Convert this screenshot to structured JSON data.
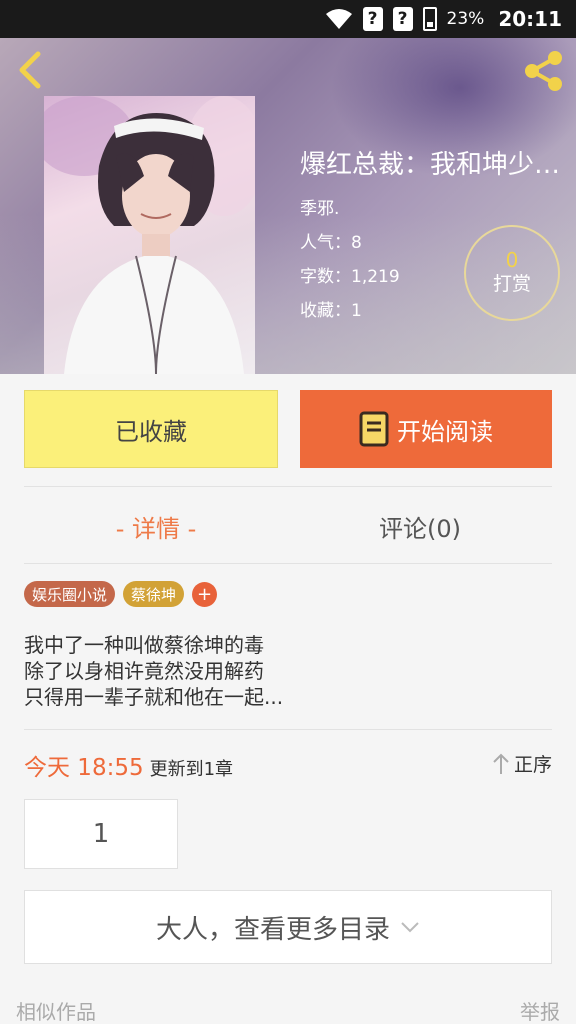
{
  "status_bar": {
    "battery": "23%",
    "time": "20:11",
    "sim1": "?",
    "sim2": "?",
    "icons": [
      "wifi-icon",
      "sim-unknown-icon",
      "battery-charging-icon"
    ]
  },
  "header": {
    "icons": [
      "back-chevron-icon",
      "share-icon"
    ],
    "accent_color": "#f2d24a"
  },
  "book": {
    "title": "爆红总裁：我和坤少…",
    "author": "季邪.",
    "popularity_label": "人气：",
    "popularity_value": "8",
    "words_label": "字数：",
    "words_value": "1,219",
    "favorites_label": "收藏：",
    "favorites_value": "1"
  },
  "tip": {
    "count": "0",
    "label": "打赏"
  },
  "actions": {
    "favorited_label": "已收藏",
    "start_read_label": "开始阅读",
    "favorited_color": "#fbf07a",
    "start_read_color": "#ee6a3a"
  },
  "tabs": {
    "detail": "- 详情 -",
    "comments": "评论(0)"
  },
  "tags": {
    "items": [
      "娱乐圈小说",
      "蔡徐坤"
    ],
    "add": "+"
  },
  "description": {
    "line1": "我中了一种叫做蔡徐坤的毒",
    "line2": "除了以身相许竟然没用解药",
    "line3": "只得用一辈子就和他在一起..."
  },
  "update": {
    "time": "今天 18:55",
    "text": "更新到1章",
    "sort_label": "正序"
  },
  "chapters": {
    "first": "1",
    "more_label": "大人，查看更多目录"
  },
  "footer": {
    "similar": "相似作品",
    "report": "举报"
  }
}
